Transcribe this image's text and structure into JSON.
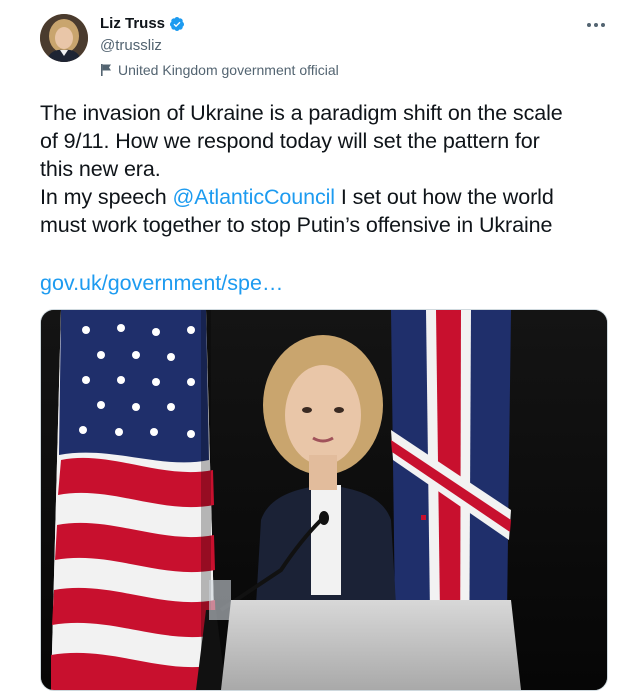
{
  "author": {
    "name": "Liz Truss",
    "handle": "@trussliz",
    "affiliation_label": "United Kingdom government official",
    "avatar_icon": "profile-avatar",
    "verified_icon": "verified-badge-icon"
  },
  "tweet": {
    "line1": "The invasion of Ukraine is a paradigm shift on the scale",
    "line2": "of 9/11. How we respond today will set the pattern for",
    "line3": "this new era.",
    "line4_prefix": "In my speech ",
    "mention": "@AtlanticCouncil",
    "line4_suffix": " I set out how the world",
    "line5": "must work together to stop Putin’s offensive in Ukraine",
    "link": "gov.uk/government/spe…"
  },
  "colors": {
    "accent": "#1d9bf0",
    "text": "#0f1419",
    "secondary": "#536471"
  },
  "icons": {
    "more": "more-horizontal-icon",
    "flag": "flag-icon"
  }
}
